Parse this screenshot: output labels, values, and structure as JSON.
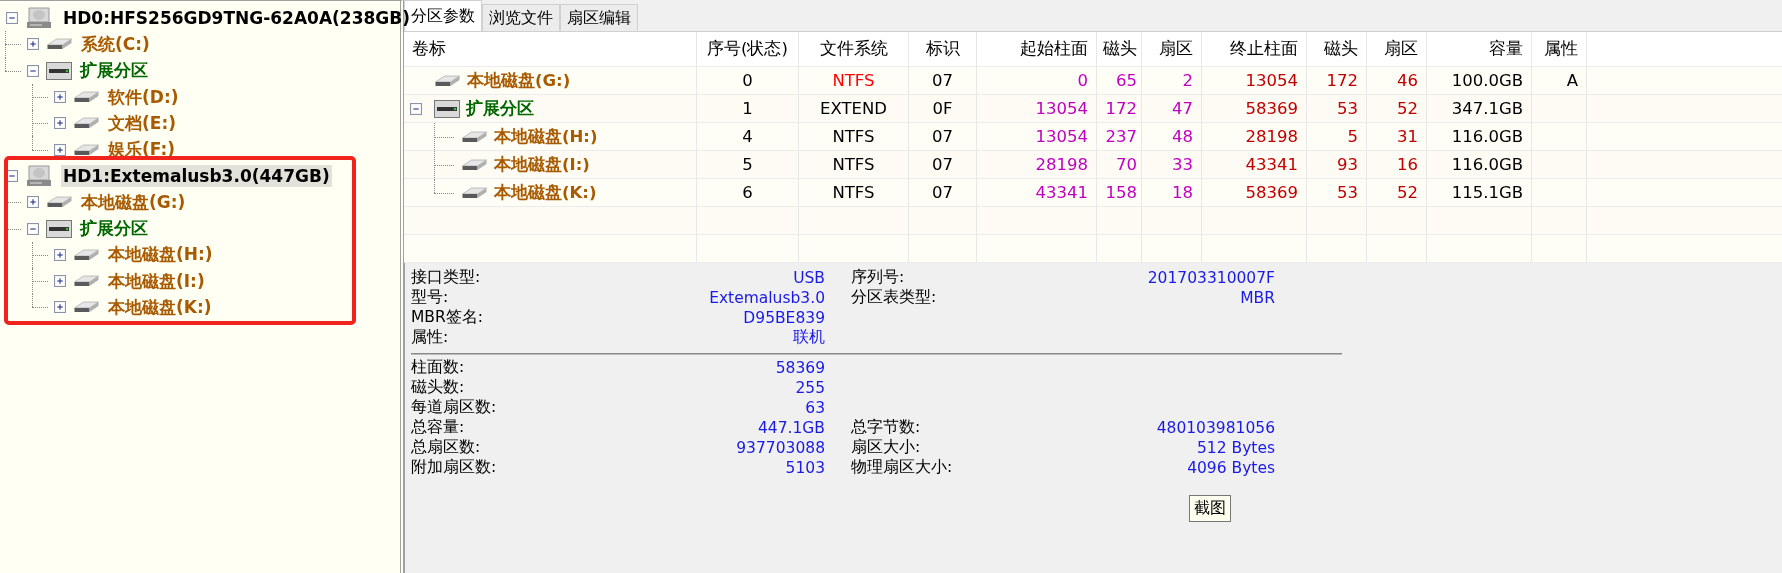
{
  "disks": [
    {
      "label": "HD0:HFS256GD9TNG-62A0A(238GB)",
      "selected": false,
      "highlighted": false,
      "expanded": true,
      "children": [
        {
          "kind": "partition",
          "label": "系统(C:)",
          "expanded": false
        },
        {
          "kind": "extended",
          "label": "扩展分区",
          "expanded": true,
          "children": [
            {
              "kind": "partition",
              "label": "软件(D:)",
              "expanded": false
            },
            {
              "kind": "partition",
              "label": "文档(E:)",
              "expanded": false
            },
            {
              "kind": "partition",
              "label": "娱乐(F:)",
              "expanded": false
            }
          ]
        }
      ]
    },
    {
      "label": "HD1:Extemalusb3.0(447GB)",
      "selected": true,
      "highlighted": true,
      "expanded": true,
      "children": [
        {
          "kind": "partition",
          "label": "本地磁盘(G:)",
          "expanded": false
        },
        {
          "kind": "extended",
          "label": "扩展分区",
          "expanded": true,
          "children": [
            {
              "kind": "partition",
              "label": "本地磁盘(H:)",
              "expanded": false
            },
            {
              "kind": "partition",
              "label": "本地磁盘(I:)",
              "expanded": false
            },
            {
              "kind": "partition",
              "label": "本地磁盘(K:)",
              "expanded": false
            }
          ]
        }
      ]
    }
  ],
  "tabs": [
    {
      "label": "分区参数",
      "selected": true
    },
    {
      "label": "浏览文件",
      "selected": false
    },
    {
      "label": "扇区编辑",
      "selected": false
    }
  ],
  "table": {
    "columns": [
      "卷标",
      "序号(状态)",
      "文件系统",
      "标识",
      "起始柱面",
      "磁头",
      "扇区",
      "终止柱面",
      "磁头",
      "扇区",
      "容量",
      "属性"
    ],
    "rows": [
      {
        "kind": "partition",
        "volume": "本地磁盘(G:)",
        "index": "0",
        "filesystem": {
          "text": "NTFS",
          "color": "#ff0000"
        },
        "id": "07",
        "start": [
          "0",
          "65",
          "2"
        ],
        "end": [
          "13054",
          "172",
          "46"
        ],
        "capacity": "100.0GB",
        "attribute": "A"
      },
      {
        "kind": "extended",
        "volume": "扩展分区",
        "expanded": true,
        "index": "1",
        "filesystem": {
          "text": "EXTEND",
          "color": "#000000"
        },
        "id": "0F",
        "start": [
          "13054",
          "172",
          "47"
        ],
        "end": [
          "58369",
          "53",
          "52"
        ],
        "capacity": "347.1GB",
        "children": [
          {
            "kind": "partition",
            "volume": "本地磁盘(H:)",
            "index": "4",
            "filesystem": {
              "text": "NTFS",
              "color": "#000000"
            },
            "id": "07",
            "start": [
              "13054",
              "237",
              "48"
            ],
            "end": [
              "28198",
              "5",
              "31"
            ],
            "capacity": "116.0GB"
          },
          {
            "kind": "partition",
            "volume": "本地磁盘(I:)",
            "index": "5",
            "filesystem": {
              "text": "NTFS",
              "color": "#000000"
            },
            "id": "07",
            "start": [
              "28198",
              "70",
              "33"
            ],
            "end": [
              "43341",
              "93",
              "16"
            ],
            "capacity": "116.0GB"
          },
          {
            "kind": "partition",
            "volume": "本地磁盘(K:)",
            "index": "6",
            "filesystem": {
              "text": "NTFS",
              "color": "#000000"
            },
            "id": "07",
            "start": [
              "43341",
              "158",
              "18"
            ],
            "end": [
              "58369",
              "53",
              "52"
            ],
            "capacity": "115.1GB"
          }
        ]
      }
    ]
  },
  "info": [
    {
      "rows": [
        {
          "left": {
            "label": "接口类型:",
            "value": "USB"
          },
          "right": {
            "label": "序列号:",
            "value": "201703310007F"
          }
        },
        {
          "left": {
            "label": "型号:",
            "value": "Extemalusb3.0"
          },
          "right": {
            "label": "分区表类型:",
            "value": "MBR"
          }
        },
        {
          "left": {
            "label": "MBR签名:",
            "value": "D95BE839"
          }
        },
        {
          "left": {
            "label": "属性:",
            "value": "联机"
          }
        }
      ]
    },
    {
      "rows": [
        {
          "left": {
            "label": "柱面数:",
            "value": "58369"
          }
        },
        {
          "left": {
            "label": "磁头数:",
            "value": "255"
          }
        },
        {
          "left": {
            "label": "每道扇区数:",
            "value": "63"
          }
        },
        {
          "left": {
            "label": "总容量:",
            "value": "447.1GB"
          },
          "right": {
            "label": "总字节数:",
            "value": "480103981056"
          }
        },
        {
          "left": {
            "label": "总扇区数:",
            "value": "937703088"
          },
          "right": {
            "label": "扇区大小:",
            "value": "512 Bytes"
          }
        },
        {
          "left": {
            "label": "附加扇区数:",
            "value": "5103"
          },
          "right": {
            "label": "物理扇区大小:",
            "value": "4096 Bytes"
          }
        }
      ]
    }
  ],
  "button": "截图"
}
